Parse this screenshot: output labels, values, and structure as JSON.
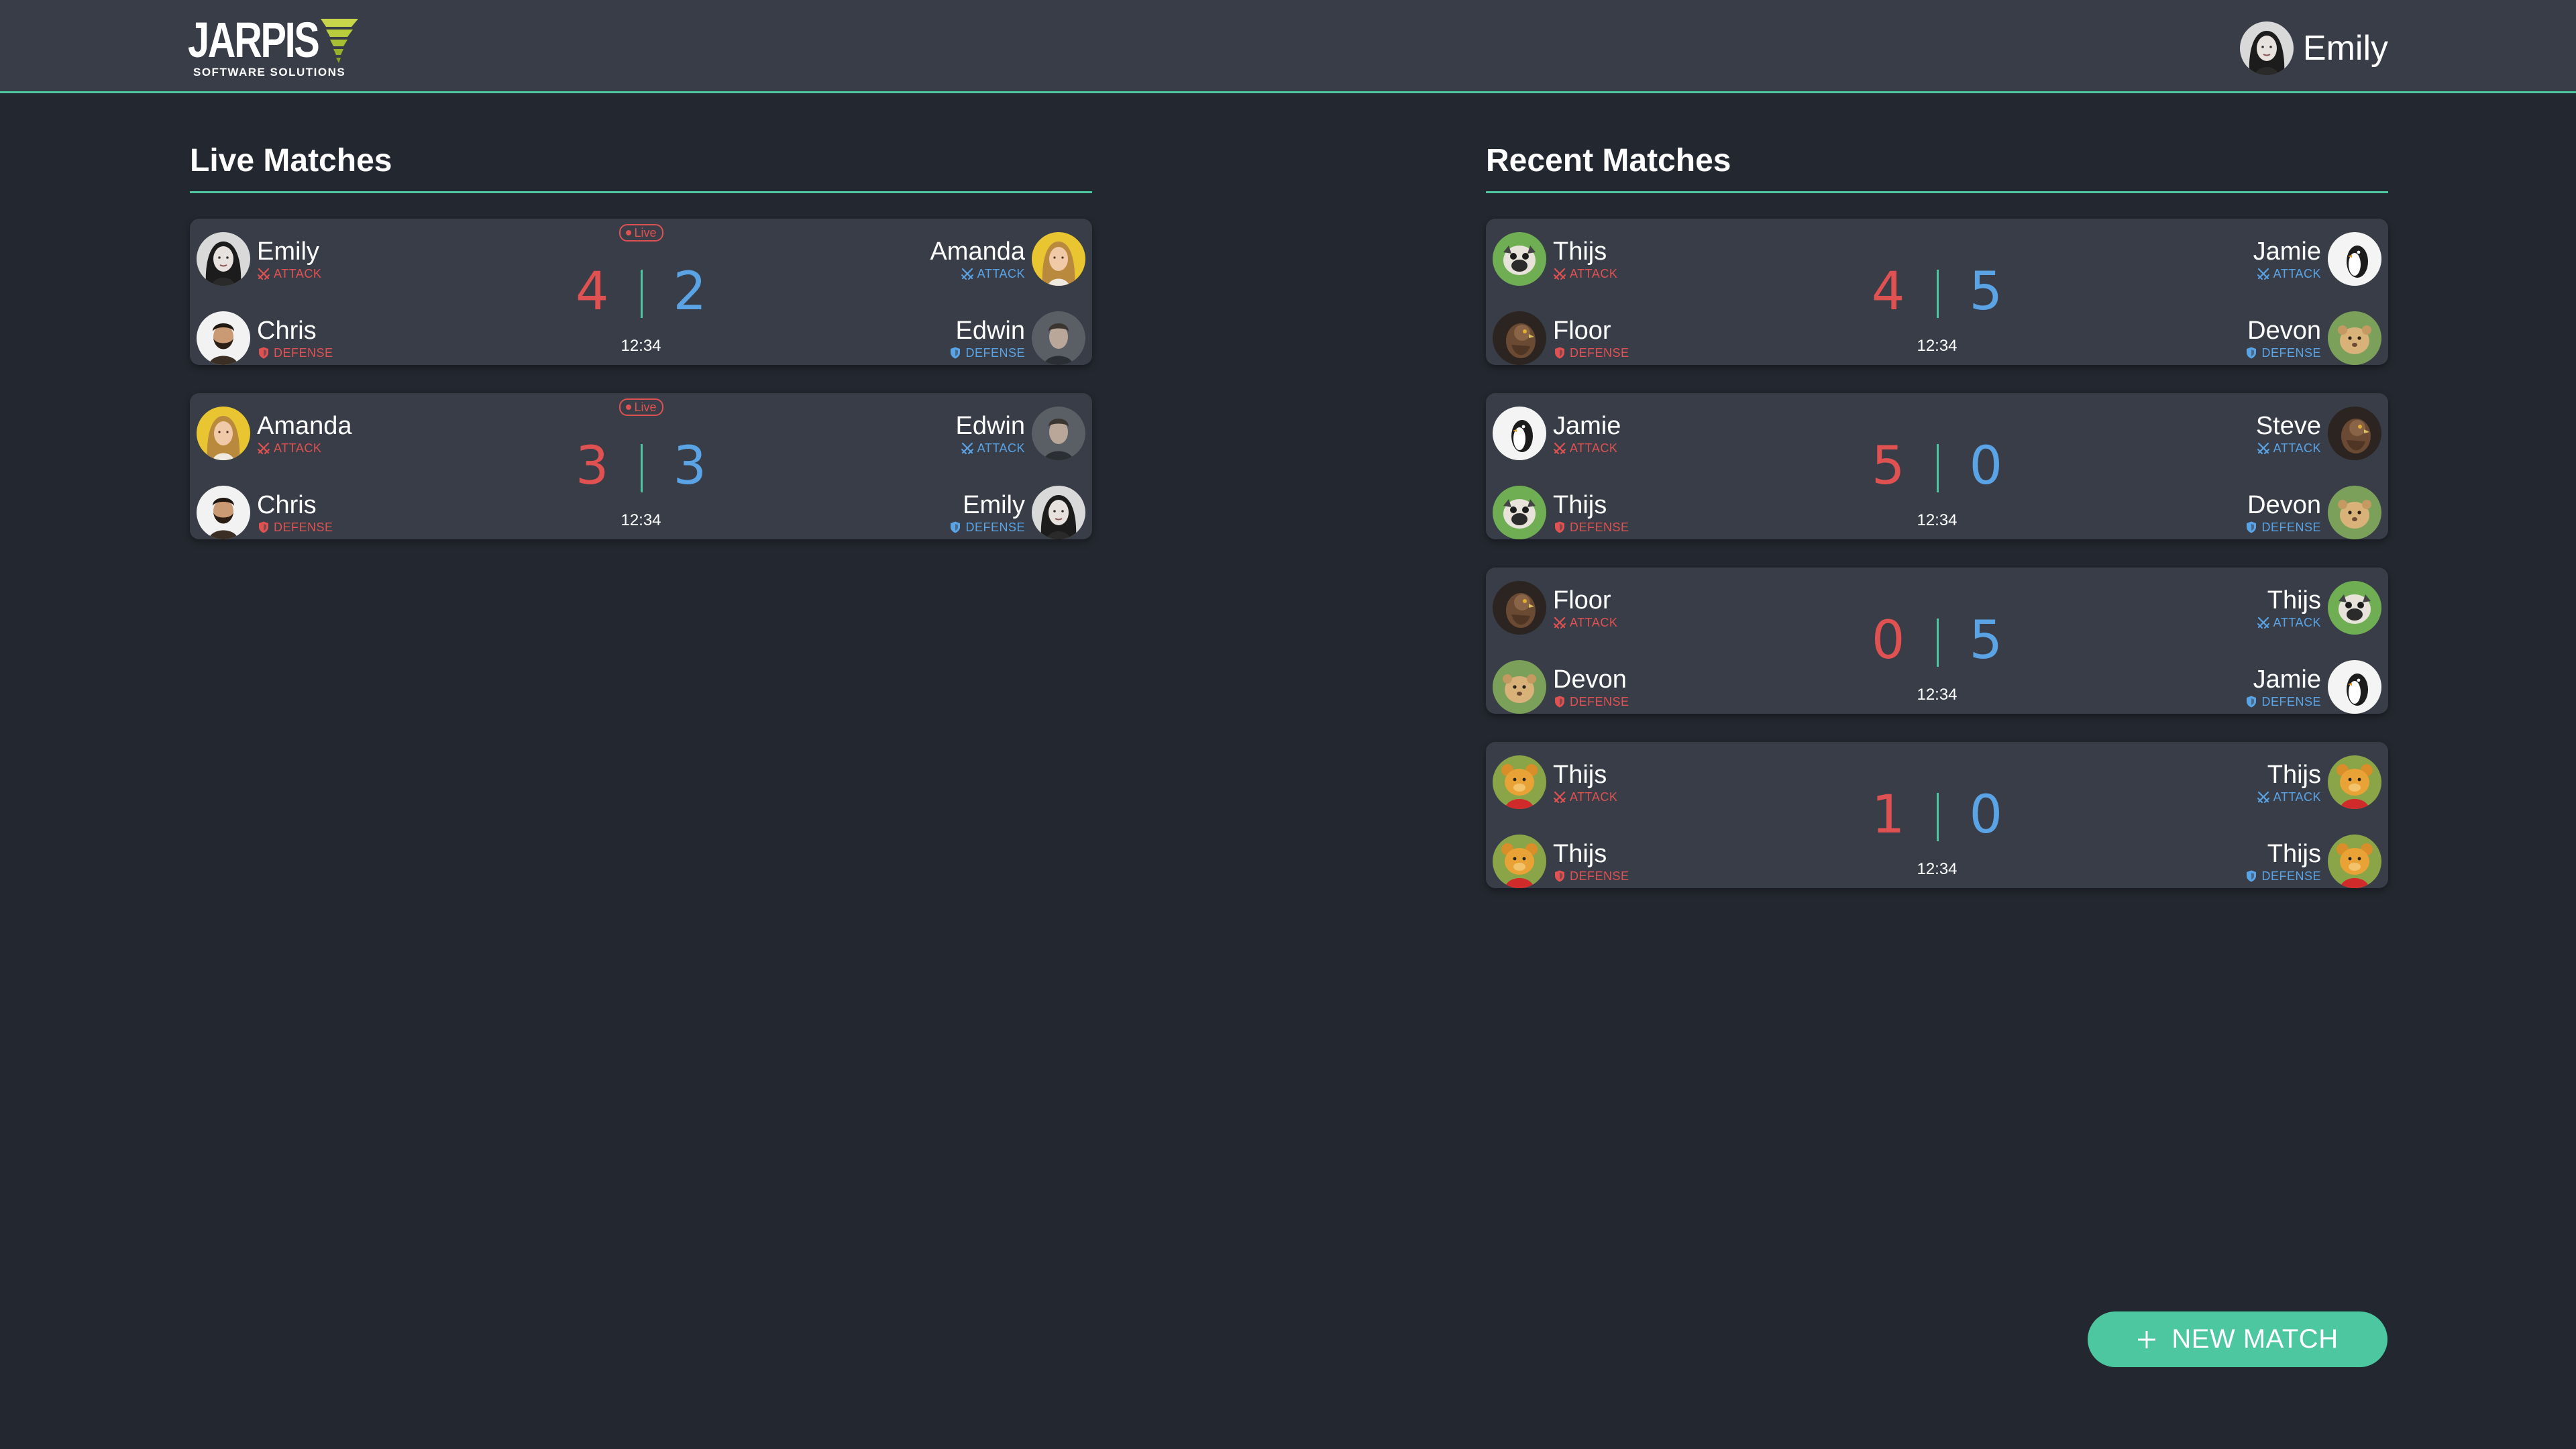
{
  "brand": {
    "name": "JARPIS",
    "tagline": "SOFTWARE SOLUTIONS"
  },
  "user": {
    "name": "Emily",
    "avatar_icon": "avatar-woman-dark-hair"
  },
  "colors": {
    "accent": "#4cc79f",
    "red_team": "#e05252",
    "blue_team": "#5aa4e6",
    "card": "#383d47",
    "background": "#23272f"
  },
  "live": {
    "title": "Live Matches",
    "matches": [
      {
        "badge": "Live",
        "red_attack": {
          "name": "Emily",
          "role": "ATTACK",
          "avatar": "woman-dark-hair"
        },
        "red_defense": {
          "name": "Chris",
          "role": "DEFENSE",
          "avatar": "man-beard"
        },
        "blue_attack": {
          "name": "Amanda",
          "role": "ATTACK",
          "avatar": "woman-blonde"
        },
        "blue_defense": {
          "name": "Edwin",
          "role": "DEFENSE",
          "avatar": "man-grey"
        },
        "red_score": "4",
        "blue_score": "2",
        "time": "12:34"
      },
      {
        "badge": "Live",
        "red_attack": {
          "name": "Amanda",
          "role": "ATTACK",
          "avatar": "woman-blonde"
        },
        "red_defense": {
          "name": "Chris",
          "role": "DEFENSE",
          "avatar": "man-beard"
        },
        "blue_attack": {
          "name": "Edwin",
          "role": "ATTACK",
          "avatar": "man-grey"
        },
        "blue_defense": {
          "name": "Emily",
          "role": "DEFENSE",
          "avatar": "woman-dark-hair"
        },
        "red_score": "3",
        "blue_score": "3",
        "time": "12:34"
      }
    ]
  },
  "recent": {
    "title": "Recent Matches",
    "matches": [
      {
        "red_attack": {
          "name": "Thijs",
          "role": "ATTACK",
          "avatar": "pug"
        },
        "red_defense": {
          "name": "Floor",
          "role": "DEFENSE",
          "avatar": "hawk"
        },
        "blue_attack": {
          "name": "Jamie",
          "role": "ATTACK",
          "avatar": "penguin"
        },
        "blue_defense": {
          "name": "Devon",
          "role": "DEFENSE",
          "avatar": "lion-cub"
        },
        "red_score": "4",
        "blue_score": "5",
        "time": "12:34"
      },
      {
        "red_attack": {
          "name": "Jamie",
          "role": "ATTACK",
          "avatar": "penguin"
        },
        "red_defense": {
          "name": "Thijs",
          "role": "DEFENSE",
          "avatar": "pug"
        },
        "blue_attack": {
          "name": "Steve",
          "role": "ATTACK",
          "avatar": "hawk"
        },
        "blue_defense": {
          "name": "Devon",
          "role": "DEFENSE",
          "avatar": "lion-cub"
        },
        "red_score": "5",
        "blue_score": "0",
        "time": "12:34"
      },
      {
        "red_attack": {
          "name": "Floor",
          "role": "ATTACK",
          "avatar": "hawk"
        },
        "red_defense": {
          "name": "Devon",
          "role": "DEFENSE",
          "avatar": "lion-cub"
        },
        "blue_attack": {
          "name": "Thijs",
          "role": "ATTACK",
          "avatar": "pug"
        },
        "blue_defense": {
          "name": "Jamie",
          "role": "DEFENSE",
          "avatar": "penguin"
        },
        "red_score": "0",
        "blue_score": "5",
        "time": "12:34"
      },
      {
        "red_attack": {
          "name": "Thijs",
          "role": "ATTACK",
          "avatar": "bear"
        },
        "red_defense": {
          "name": "Thijs",
          "role": "DEFENSE",
          "avatar": "bear"
        },
        "blue_attack": {
          "name": "Thijs",
          "role": "ATTACK",
          "avatar": "bear"
        },
        "blue_defense": {
          "name": "Thijs",
          "role": "DEFENSE",
          "avatar": "bear"
        },
        "red_score": "1",
        "blue_score": "0",
        "time": "12:34"
      }
    ]
  },
  "actions": {
    "new_match_label": "NEW MATCH",
    "new_match_icon": "plus-icon"
  }
}
